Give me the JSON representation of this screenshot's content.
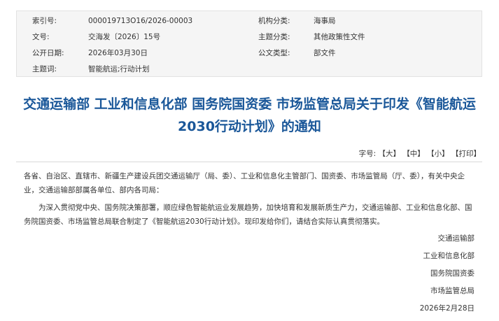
{
  "meta": {
    "rows": [
      {
        "k1": "索引号:",
        "v1": "000019713O16/2026-00003",
        "k2": "机构分类:",
        "v2": "海事局"
      },
      {
        "k1": "文号:",
        "v1": "交海发〔2026〕15号",
        "k2": "主题分类:",
        "v2": "其他政策性文件"
      },
      {
        "k1": "公开日期:",
        "v1": "2026年03月30日",
        "k2": "公文类型:",
        "v2": "部文件"
      },
      {
        "k1": "主题词:",
        "v1": "智能航运;行动计划"
      }
    ]
  },
  "title": "交通运输部 工业和信息化部 国务院国资委 市场监管总局关于印发《智能航运2030行动计划》的通知",
  "font_tools": {
    "label": "字号:",
    "large": "【大】",
    "medium": "【中】",
    "small": "【小】",
    "print": "【打印】"
  },
  "body": {
    "p1": "各省、自治区、直辖市、新疆生产建设兵团交通运输厅（局、委）、工业和信息化主管部门、国资委、市场监管局（厅、委），有关中央企业，交通运输部部属各单位、部内各司局：",
    "p2": "为深入贯彻党中央、国务院决策部署，顺应绿色智能航运业发展趋势，加快培育和发展新质生产力，交通运输部、工业和信息化部、国务院国资委、市场监管总局联合制定了《智能航运2030行动计划》。现印发给你们，请结合实际认真贯彻落实。"
  },
  "signatures": [
    "交通运输部",
    "工业和信息化部",
    "国务院国资委",
    "市场监管总局"
  ],
  "date": "2026年2月28日"
}
